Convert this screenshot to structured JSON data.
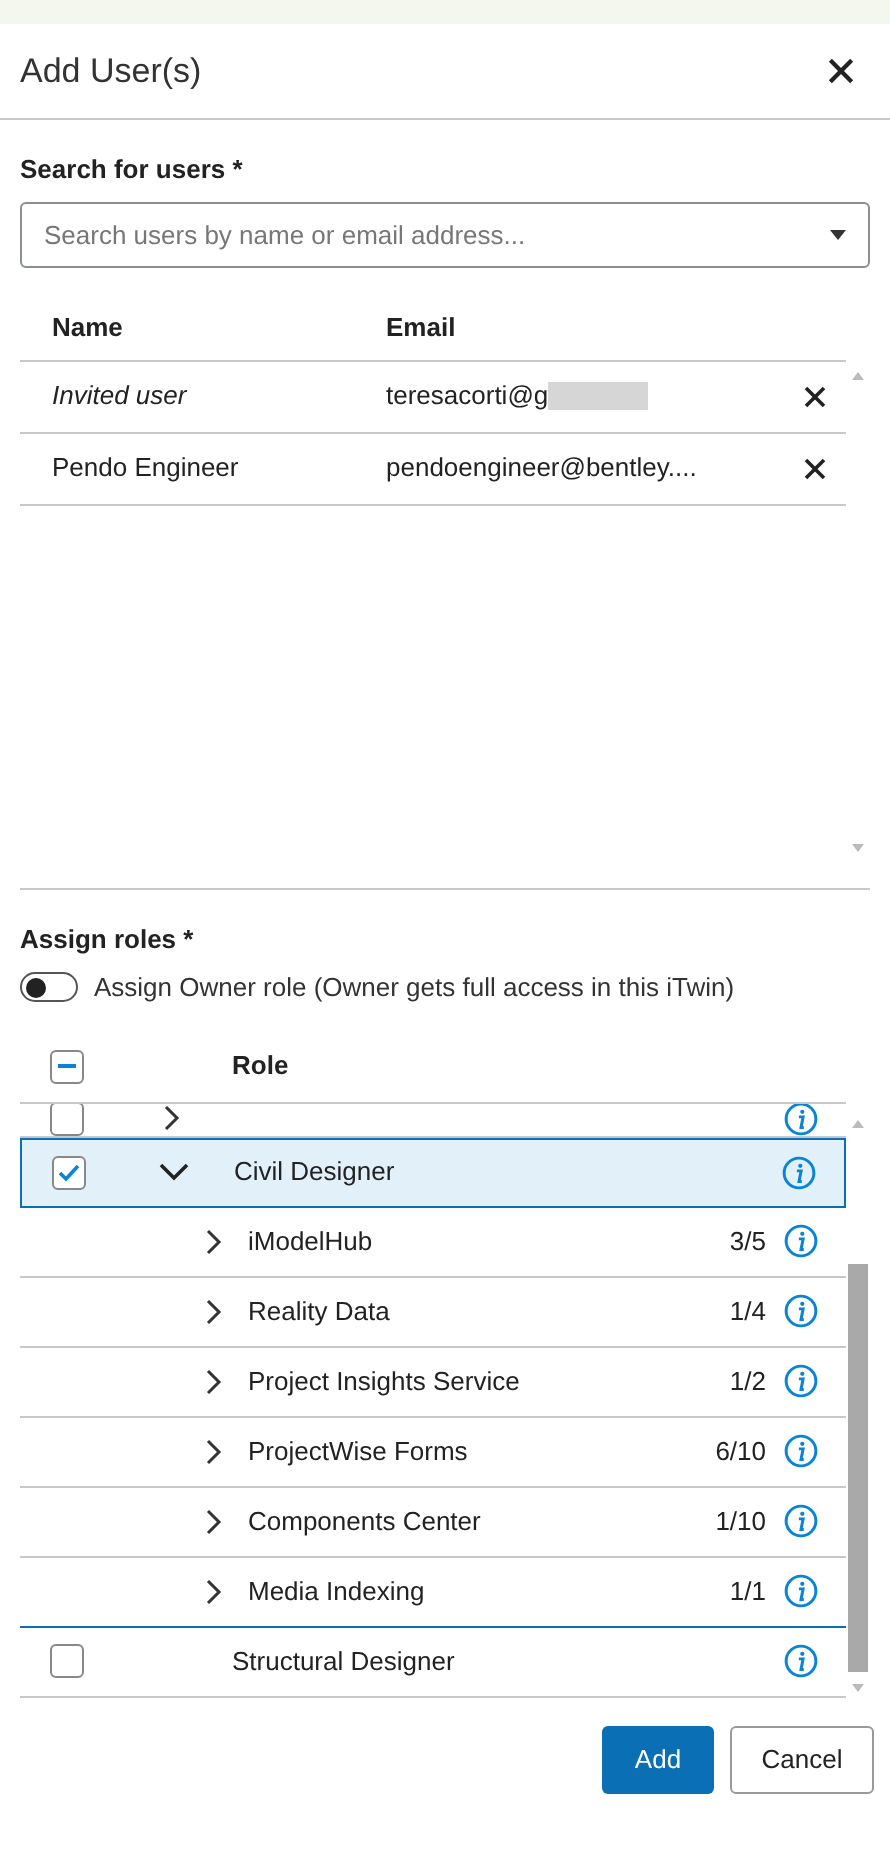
{
  "dialog": {
    "title": "Add User(s)"
  },
  "search": {
    "label": "Search for users *",
    "placeholder": "Search users by name or email address..."
  },
  "users_table": {
    "columns": [
      "Name",
      "Email"
    ],
    "rows": [
      {
        "name": "Invited user",
        "invited": true,
        "email": "teresacorti@g",
        "email_blurred": true
      },
      {
        "name": "Pendo Engineer",
        "invited": false,
        "email": "pendoengineer@bentley....",
        "email_blurred": false
      }
    ]
  },
  "roles": {
    "label": "Assign roles *",
    "owner_toggle": {
      "label": "Assign Owner role (Owner gets full access in this iTwin)",
      "on": false
    },
    "header": {
      "label": "Role",
      "indeterminate": true
    },
    "partial_row": {
      "checked": false,
      "expanded": false
    },
    "items": [
      {
        "label": "Civil Designer",
        "kind": "group",
        "checked": true,
        "expanded": true,
        "selected": true,
        "children": [
          {
            "label": "iModelHub",
            "count": "3/5"
          },
          {
            "label": "Reality Data",
            "count": "1/4"
          },
          {
            "label": "Project Insights Service",
            "count": "1/2"
          },
          {
            "label": "ProjectWise Forms",
            "count": "6/10"
          },
          {
            "label": "Components Center",
            "count": "1/10"
          },
          {
            "label": "Media Indexing",
            "count": "1/1"
          }
        ]
      },
      {
        "label": "Structural Designer",
        "kind": "leaf",
        "checked": false,
        "selected": false
      }
    ]
  },
  "buttons": [
    {
      "label": "Add",
      "kind": "primary"
    },
    {
      "label": "Cancel",
      "kind": "secondary"
    }
  ]
}
